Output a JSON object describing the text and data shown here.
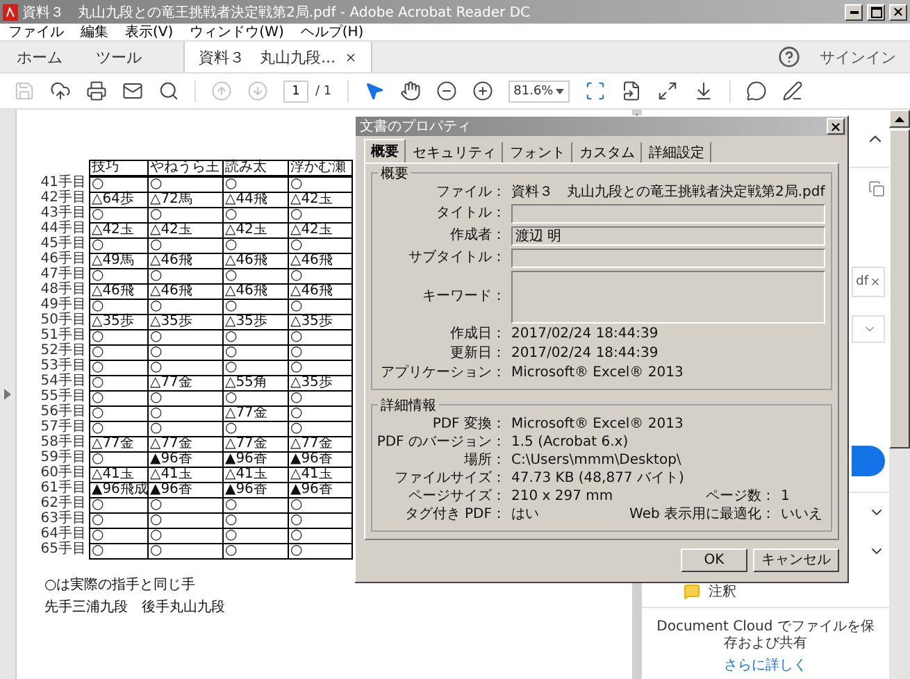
{
  "window": {
    "title": "資料３　丸山九段との竜王挑戦者決定戦第2局.pdf - Adobe Acrobat Reader DC"
  },
  "menu": [
    "ファイル",
    "編集",
    "表示(V)",
    "ウィンドウ(W)",
    "ヘルプ(H)"
  ],
  "tabs": [
    {
      "label": "ホーム",
      "selected": false,
      "closable": false
    },
    {
      "label": "ツール",
      "selected": false,
      "closable": false
    },
    {
      "label": "資料３　丸山九段...",
      "selected": true,
      "closable": true
    }
  ],
  "sign_in": "サインイン",
  "toolbar": [
    {
      "kind": "save",
      "disabled": true
    },
    {
      "kind": "upload",
      "disabled": false
    },
    {
      "kind": "print",
      "disabled": false
    },
    {
      "kind": "mail",
      "disabled": false
    },
    {
      "kind": "search",
      "disabled": false
    },
    {
      "kind": "separator"
    },
    {
      "kind": "prev",
      "disabled": true
    },
    {
      "kind": "next",
      "disabled": true
    },
    {
      "kind": "page",
      "value": "1",
      "total": "/ 1"
    },
    {
      "kind": "separator"
    },
    {
      "kind": "select",
      "disabled": false
    },
    {
      "kind": "hand",
      "disabled": false
    },
    {
      "kind": "zoom-out",
      "disabled": false
    },
    {
      "kind": "zoom-in",
      "disabled": false
    },
    {
      "kind": "zoom",
      "value": "81.6%"
    },
    {
      "kind": "fit",
      "disabled": false
    },
    {
      "kind": "rotate",
      "disabled": false
    },
    {
      "kind": "fullscreen",
      "disabled": false
    },
    {
      "kind": "read",
      "disabled": false
    },
    {
      "kind": "separator"
    },
    {
      "kind": "comment",
      "disabled": false
    },
    {
      "kind": "pen",
      "disabled": false
    }
  ],
  "document": {
    "columns": [
      "技巧",
      "やねうら王",
      "読み太",
      "浮かむ瀬"
    ],
    "rows": [
      {
        "label": "41手目",
        "cells": [
          "○",
          "○",
          "○",
          "○"
        ]
      },
      {
        "label": "42手目",
        "cells": [
          "△64歩",
          "△72馬",
          "△44飛",
          "△42玉"
        ]
      },
      {
        "label": "43手目",
        "cells": [
          "○",
          "○",
          "○",
          "○"
        ]
      },
      {
        "label": "44手目",
        "cells": [
          "△42玉",
          "△42玉",
          "△42玉",
          "△42玉"
        ]
      },
      {
        "label": "45手目",
        "cells": [
          "○",
          "○",
          "○",
          "○"
        ]
      },
      {
        "label": "46手目",
        "cells": [
          "△49馬",
          "△46飛",
          "△46飛",
          "△46飛"
        ]
      },
      {
        "label": "47手目",
        "cells": [
          "○",
          "○",
          "○",
          "○"
        ]
      },
      {
        "label": "48手目",
        "cells": [
          "△46飛",
          "△46飛",
          "△46飛",
          "△46飛"
        ]
      },
      {
        "label": "49手目",
        "cells": [
          "○",
          "○",
          "○",
          "○"
        ]
      },
      {
        "label": "50手目",
        "cells": [
          "△35歩",
          "△35歩",
          "△35歩",
          "△35歩"
        ]
      },
      {
        "label": "51手目",
        "cells": [
          "○",
          "○",
          "○",
          "○"
        ]
      },
      {
        "label": "52手目",
        "cells": [
          "○",
          "○",
          "○",
          "○"
        ]
      },
      {
        "label": "53手目",
        "cells": [
          "○",
          "○",
          "○",
          "○"
        ]
      },
      {
        "label": "54手目",
        "cells": [
          "○",
          "△77金",
          "△55角",
          "△35歩"
        ]
      },
      {
        "label": "55手目",
        "cells": [
          "○",
          "○",
          "○",
          "○"
        ]
      },
      {
        "label": "56手目",
        "cells": [
          "○",
          "○",
          "△77金",
          "○"
        ]
      },
      {
        "label": "57手目",
        "cells": [
          "○",
          "○",
          "○",
          "○"
        ]
      },
      {
        "label": "58手目",
        "cells": [
          "△77金",
          "△77金",
          "△77金",
          "△77金"
        ]
      },
      {
        "label": "59手目",
        "cells": [
          "○",
          "▲96香",
          "▲96香",
          "▲96香"
        ]
      },
      {
        "label": "60手目",
        "cells": [
          "△41玉",
          "△41玉",
          "△41玉",
          "△41玉"
        ]
      },
      {
        "label": "61手目",
        "cells": [
          "▲96飛成",
          "▲96香",
          "▲96香",
          "▲96香"
        ]
      },
      {
        "label": "62手目",
        "cells": [
          "○",
          "○",
          "○",
          "○"
        ]
      },
      {
        "label": "63手目",
        "cells": [
          "○",
          "○",
          "○",
          "○"
        ]
      },
      {
        "label": "64手目",
        "cells": [
          "○",
          "○",
          "○",
          "○"
        ]
      },
      {
        "label": "65手目",
        "cells": [
          "○",
          "○",
          "○",
          "○"
        ]
      }
    ],
    "notes": [
      "○は実際の指手と同じ手",
      "先手三浦九段　後手丸山九段"
    ]
  },
  "side_panel": {
    "chip": "df",
    "annotation": "注釈",
    "cloud_text": "Document Cloud でファイルを保存および共有",
    "link": "さらに詳しく"
  },
  "dialog": {
    "title": "文書のプロパティ",
    "tabs": [
      {
        "label": "概要",
        "selected": true
      },
      {
        "label": "セキュリティ",
        "selected": false
      },
      {
        "label": "フォント",
        "selected": false
      },
      {
        "label": "カスタム",
        "selected": false
      },
      {
        "label": "詳細設定",
        "selected": false
      }
    ],
    "summary": {
      "legend": "概要",
      "rows": [
        {
          "kind": "text",
          "label": "ファイル：",
          "value": "資料３　丸山九段との竜王挑戦者決定戦第2局.pdf"
        },
        {
          "kind": "field",
          "label": "タイトル："
        },
        {
          "kind": "field",
          "label": "作成者：",
          "value": "渡辺 明"
        },
        {
          "kind": "field",
          "label": "サブタイトル："
        },
        {
          "kind": "area",
          "label": "キーワード："
        },
        {
          "kind": "text",
          "label": "作成日：",
          "value": "2017/02/24 18:44:39"
        },
        {
          "kind": "text",
          "label": "更新日：",
          "value": "2017/02/24 18:44:39"
        },
        {
          "kind": "text",
          "label": "アプリケーション：",
          "value": "Microsoft® Excel® 2013"
        }
      ]
    },
    "details": {
      "legend": "詳細情報",
      "rows": [
        {
          "label": "PDF 変換：",
          "value": "Microsoft® Excel® 2013"
        },
        {
          "label": "PDF のバージョン：",
          "value": "1.5 (Acrobat 6.x)"
        },
        {
          "label": "場所：",
          "value": "C:\\Users\\mmm\\Desktop\\"
        },
        {
          "label": "ファイルサイズ：",
          "value": "47.73 KB (48,877 バイト)"
        },
        {
          "label": "ページサイズ：",
          "value": "210 x 297 mm",
          "label2": "ページ数：",
          "value2": "1"
        },
        {
          "label": "タグ付き PDF：",
          "value": "はい",
          "label2": "Web 表示用に最適化：",
          "value2": "いいえ"
        }
      ]
    },
    "buttons": [
      "OK",
      "キャンセル"
    ]
  }
}
